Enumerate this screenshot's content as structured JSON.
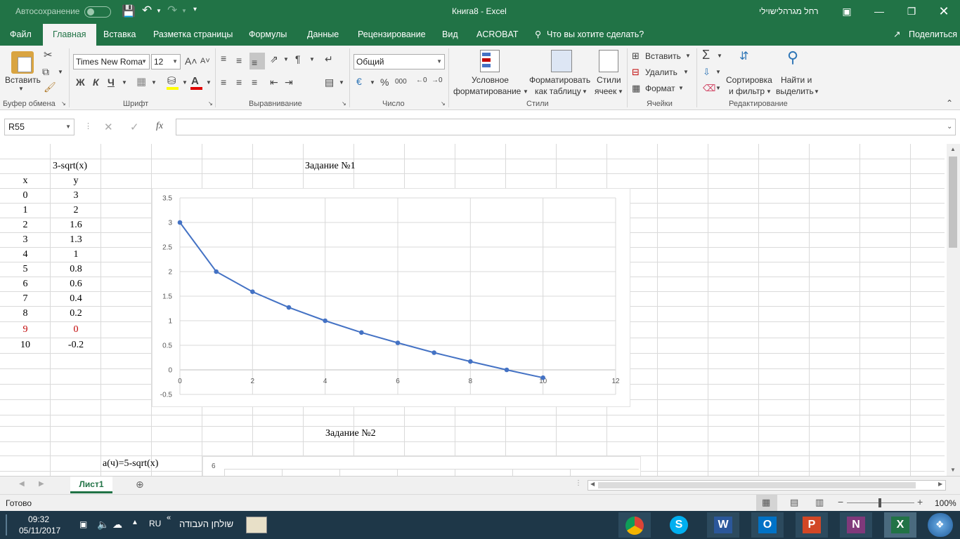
{
  "titlebar": {
    "autosave_label": "Автосохранение",
    "title": "Книга8  -  Excel",
    "user": "רחל מגרהלישוילי"
  },
  "menu": {
    "file": "Файл",
    "tabs": [
      "Главная",
      "Вставка",
      "Разметка страницы",
      "Формулы",
      "Данные",
      "Рецензирование",
      "Вид",
      "ACROBAT"
    ],
    "tell_me": "Что вы хотите сделать?",
    "share": "Поделиться"
  },
  "ribbon": {
    "clipboard": {
      "paste": "Вставить",
      "group": "Буфер обмена"
    },
    "font": {
      "name": "Times New Roma",
      "size": "12",
      "bold": "Ж",
      "italic": "К",
      "underline": "Ч",
      "group": "Шрифт"
    },
    "alignment": {
      "group": "Выравнивание"
    },
    "number": {
      "format": "Общий",
      "group": "Число"
    },
    "styles": {
      "conditional_1": "Условное",
      "conditional_2": "форматирование",
      "table_1": "Форматировать",
      "table_2": "как таблицу",
      "cell_1": "Стили",
      "cell_2": "ячеек",
      "group": "Стили"
    },
    "cells": {
      "insert": "Вставить",
      "delete": "Удалить",
      "format": "Формат",
      "group": "Ячейки"
    },
    "editing": {
      "sort_1": "Сортировка",
      "sort_2": "и фильтр",
      "find_1": "Найти и",
      "find_2": "выделить",
      "group": "Редактирование"
    }
  },
  "formula_bar": {
    "name_box": "R55",
    "fx": "fx",
    "value": ""
  },
  "sheet": {
    "header_y_formula": "3-sqrt(x)",
    "col_x": "x",
    "col_y": "y",
    "rows": [
      {
        "x": "0",
        "y": "3"
      },
      {
        "x": "1",
        "y": "2"
      },
      {
        "x": "2",
        "y": "1.6"
      },
      {
        "x": "3",
        "y": "1.3"
      },
      {
        "x": "4",
        "y": "1"
      },
      {
        "x": "5",
        "y": "0.8"
      },
      {
        "x": "6",
        "y": "0.6"
      },
      {
        "x": "7",
        "y": "0.4"
      },
      {
        "x": "8",
        "y": "0.2"
      },
      {
        "x": "9",
        "y": "0"
      },
      {
        "x": "10",
        "y": "-0.2"
      }
    ],
    "highlight_color": "#c00000",
    "task1_title": "Задание №1",
    "task2_title": "Задание №2",
    "task2_formula": "a(ч)=5-sqrt(x)",
    "chart2_first_tick": "6"
  },
  "chart_data": [
    {
      "type": "scatter",
      "title": "",
      "x": [
        0,
        1,
        2,
        3,
        4,
        5,
        6,
        7,
        8,
        9,
        10
      ],
      "y": [
        3,
        2,
        1.59,
        1.27,
        1,
        0.76,
        0.55,
        0.35,
        0.17,
        0,
        -0.16
      ],
      "xlim": [
        0,
        12
      ],
      "ylim": [
        -0.5,
        3.5
      ],
      "xticks": [
        "0",
        "2",
        "4",
        "6",
        "8",
        "10",
        "12"
      ],
      "yticks": [
        "3.5",
        "3",
        "2.5",
        "2",
        "1.5",
        "1",
        "0.5",
        "0",
        "-0.5"
      ],
      "grid": true,
      "line_color": "#4472c4",
      "markers": true
    }
  ],
  "tabs": {
    "sheet1": "Лист1"
  },
  "status": {
    "ready": "Готово",
    "zoom": "100%"
  },
  "taskbar": {
    "time": "09:32",
    "date": "05/11/2017",
    "lang": "RU",
    "desktop": "שולחן העבודה"
  },
  "colors": {
    "excel_green": "#217346",
    "ribbon_bg": "#f3f3f3",
    "taskbar": "#1e3748"
  }
}
